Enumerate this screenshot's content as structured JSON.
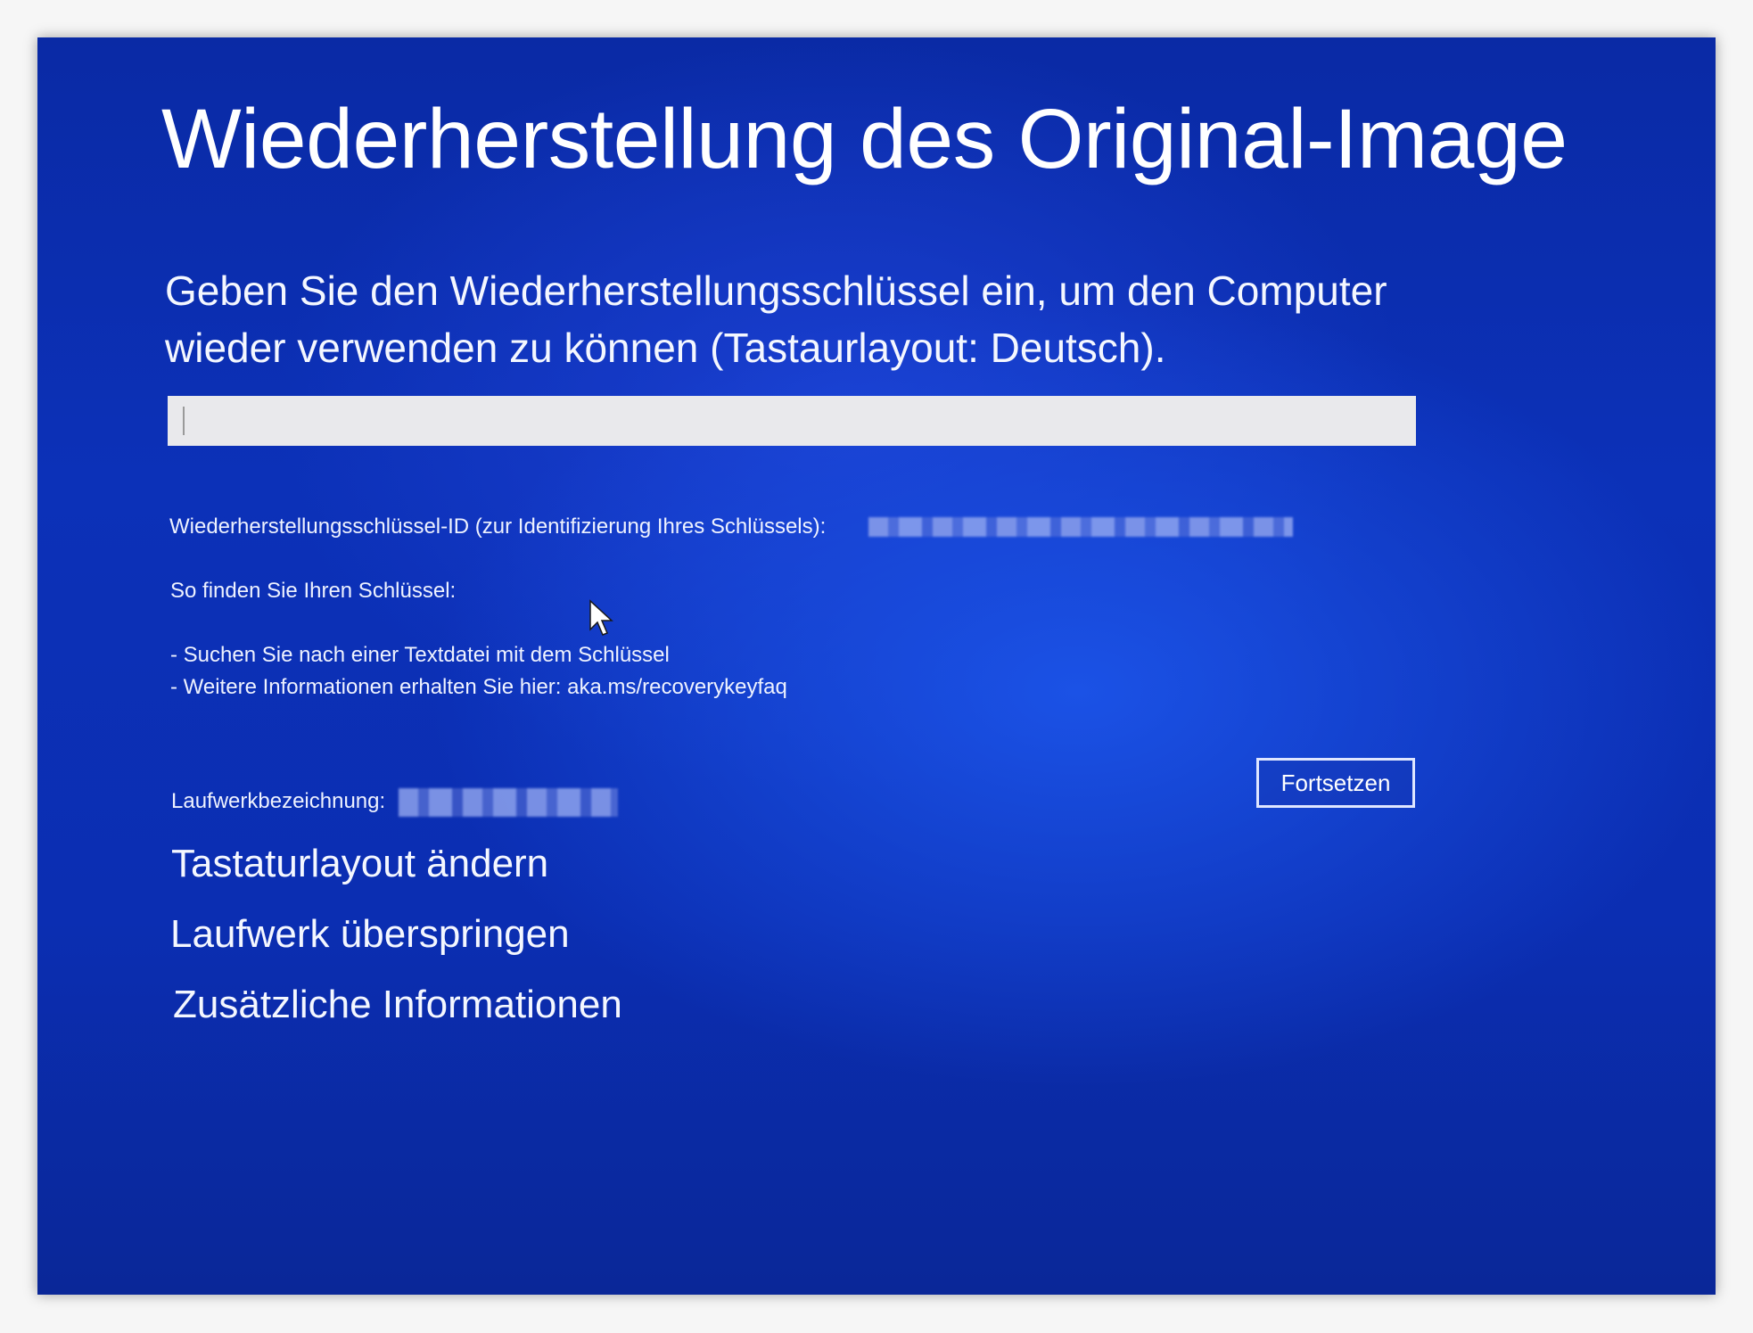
{
  "title": "Wiederherstellung des Original-Image",
  "prompt": {
    "line1": "Geben Sie den Wiederherstellungsschlüssel ein, um den Computer",
    "line2": "wieder verwenden zu können (Tastaurlayout: Deutsch)."
  },
  "recovery_key_input": {
    "value": "",
    "placeholder": ""
  },
  "key_id": {
    "label": "Wiederherstellungsschlüssel-ID (zur Identifizierung Ihres Schlüssels):"
  },
  "help": {
    "heading": "So finden Sie Ihren Schlüssel:",
    "item1": "- Suchen Sie nach einer Textdatei mit dem Schlüssel",
    "item2": "- Weitere Informationen erhalten Sie hier: aka.ms/recoverykeyfaq"
  },
  "drive": {
    "label": "Laufwerkbezeichnung:"
  },
  "buttons": {
    "continue": "Fortsetzen"
  },
  "links": {
    "change_keyboard": "Tastaturlayout ändern",
    "skip_drive": "Laufwerk überspringen",
    "more_info": "Zusätzliche Informationen"
  },
  "colors": {
    "background": "#0c31b8",
    "input_bg": "#e9e9ec",
    "text": "#ffffff"
  },
  "icons": {
    "cursor": "mouse-pointer-icon"
  }
}
